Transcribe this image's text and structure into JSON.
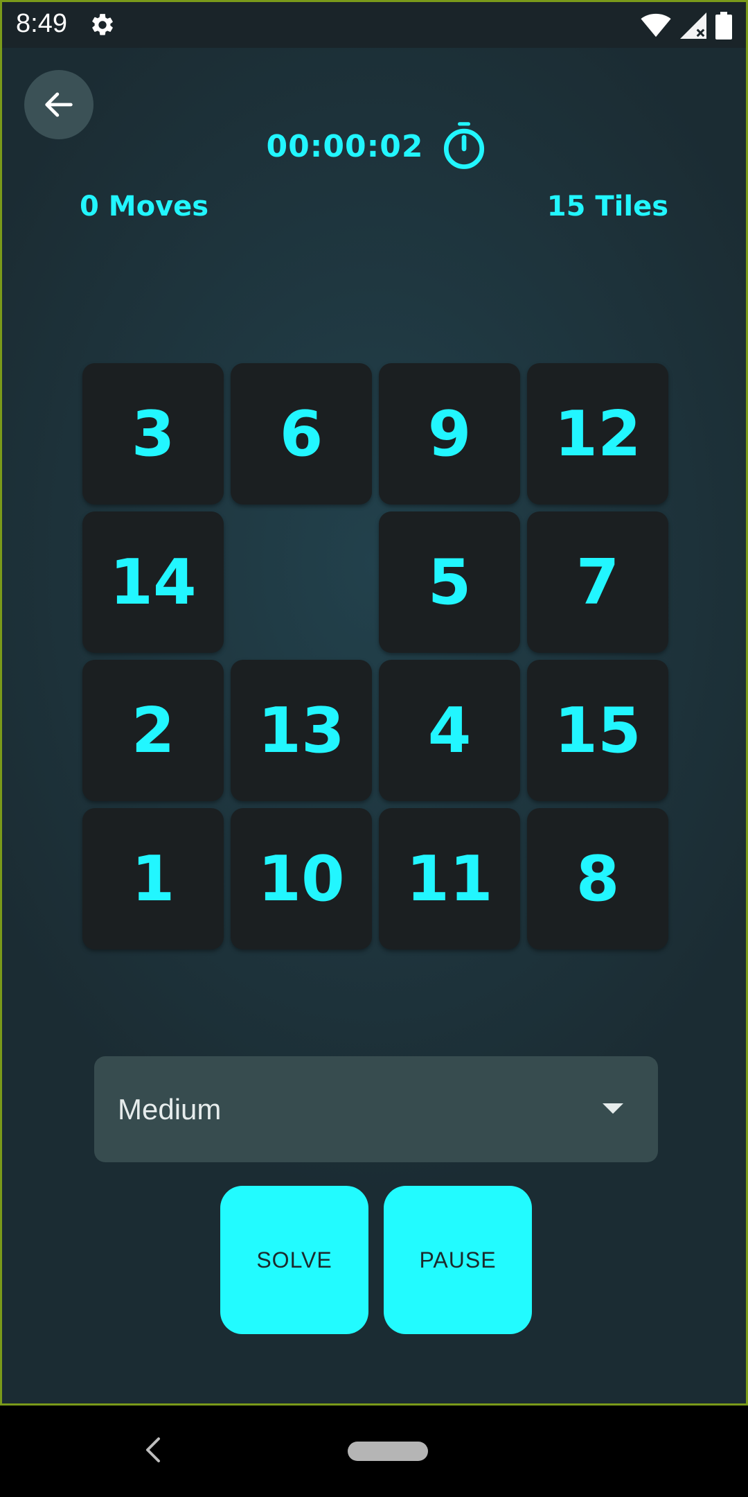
{
  "status_bar": {
    "time": "8:49",
    "icons": [
      "gear-icon",
      "wifi-icon",
      "signal-icon",
      "battery-icon"
    ]
  },
  "header": {
    "back_icon": "arrow-left-icon",
    "timer": "00:00:02",
    "timer_icon": "stopwatch-icon",
    "moves": "0 Moves",
    "tiles": "15 Tiles"
  },
  "board": {
    "rows": 4,
    "cols": 4,
    "tiles": [
      "3",
      "6",
      "9",
      "12",
      "14",
      "",
      "5",
      "7",
      "2",
      "13",
      "4",
      "15",
      "1",
      "10",
      "11",
      "8"
    ]
  },
  "difficulty": {
    "selected": "Medium",
    "icon": "dropdown-arrow-icon"
  },
  "actions": {
    "solve_label": "SOLVE",
    "pause_label": "PAUSE"
  },
  "nav_bar": {
    "icons": [
      "nav-back-icon",
      "nav-home-pill"
    ]
  },
  "colors": {
    "accent": "#22f6ff",
    "tile_bg": "#1b1f21",
    "background": "#1f3740",
    "select_bg": "#374c4f"
  }
}
